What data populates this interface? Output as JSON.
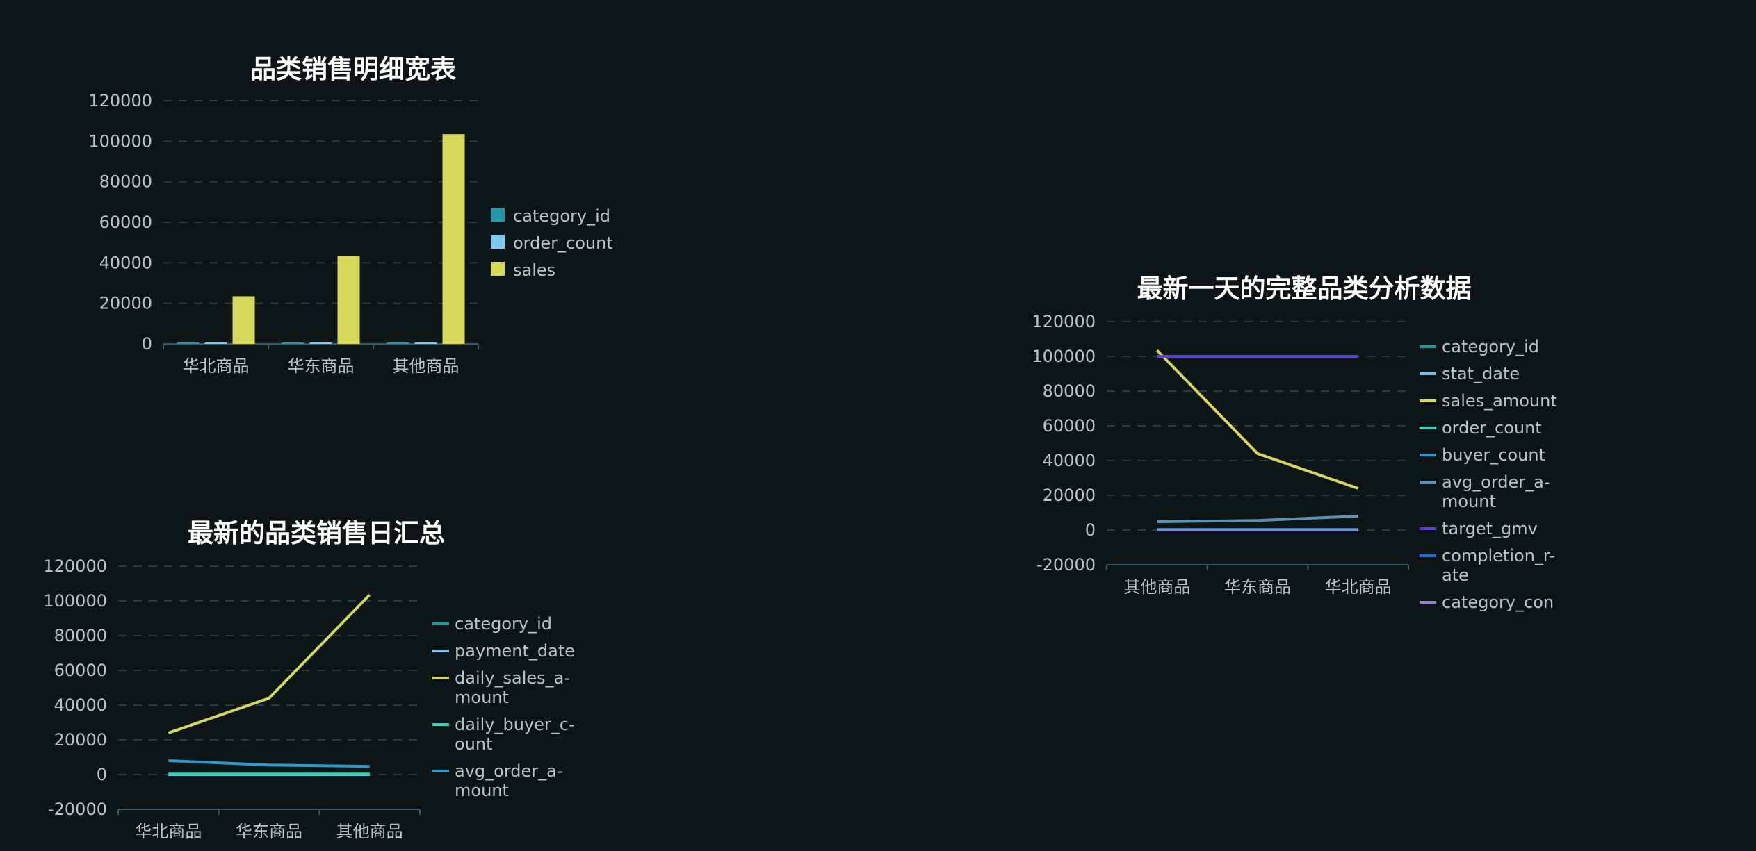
{
  "chart_data": [
    {
      "type": "bar",
      "title": "品类销售明细宽表",
      "categories": [
        "华北商品",
        "华东商品",
        "其他商品"
      ],
      "ylim": [
        0,
        120000
      ],
      "yticks": [
        "0",
        "20000",
        "40000",
        "60000",
        "80000",
        "100000",
        "120000"
      ],
      "grid": true,
      "legend_position": "right",
      "series": [
        {
          "name": "category_id",
          "color": "#2596a8",
          "values": [
            0,
            0,
            0
          ]
        },
        {
          "name": "order_count",
          "color": "#7cc9f2",
          "values": [
            0,
            0,
            0
          ]
        },
        {
          "name": "sales",
          "color": "#d6d85a",
          "values": [
            23500,
            43500,
            103500
          ]
        }
      ]
    },
    {
      "type": "line",
      "title": "最新的品类销售日汇总",
      "categories": [
        "华北商品",
        "华东商品",
        "其他商品"
      ],
      "ylim": [
        -20000,
        120000
      ],
      "yticks": [
        "-20000",
        "0",
        "20000",
        "40000",
        "60000",
        "80000",
        "100000",
        "120000"
      ],
      "grid": true,
      "legend_position": "right",
      "series": [
        {
          "name": "category_id",
          "color": "#1f9a9a",
          "values": [
            0,
            0,
            0
          ]
        },
        {
          "name": "payment_date",
          "color": "#7cc0f0",
          "values": [
            0,
            0,
            0
          ]
        },
        {
          "name": "daily_sales_a-mount",
          "color": "#d6d85a",
          "values": [
            24000,
            44000,
            103500
          ]
        },
        {
          "name": "daily_buyer_c-ount",
          "color": "#2ed8b0",
          "values": [
            300,
            300,
            300
          ]
        },
        {
          "name": "avg_order_a-mount",
          "color": "#2a9ccc",
          "values": [
            8000,
            5500,
            4700
          ]
        }
      ]
    },
    {
      "type": "line",
      "title": "最新一天的完整品类分析数据",
      "categories": [
        "其他商品",
        "华东商品",
        "华北商品"
      ],
      "ylim": [
        -20000,
        120000
      ],
      "yticks": [
        "-20000",
        "0",
        "20000",
        "40000",
        "60000",
        "80000",
        "100000",
        "120000"
      ],
      "grid": true,
      "legend_position": "right",
      "series": [
        {
          "name": "category_id",
          "color": "#1f9a9a",
          "values": [
            0,
            0,
            0
          ]
        },
        {
          "name": "stat_date",
          "color": "#7cc0f0",
          "values": [
            0,
            0,
            0
          ]
        },
        {
          "name": "sales_amount",
          "color": "#d6d85a",
          "values": [
            103500,
            44000,
            24000
          ]
        },
        {
          "name": "order_count",
          "color": "#2ed8b0",
          "values": [
            300,
            300,
            300
          ]
        },
        {
          "name": "buyer_count",
          "color": "#2a9ccc",
          "values": [
            200,
            200,
            200
          ]
        },
        {
          "name": "avg_order_a-mount",
          "color": "#5b94b8",
          "values": [
            4800,
            5500,
            8000
          ]
        },
        {
          "name": "target_gmv",
          "color": "#5a3fe0",
          "values": [
            100000,
            100000,
            100000
          ]
        },
        {
          "name": "completion_r-ate",
          "color": "#1f6fe0",
          "values": [
            1,
            1,
            1
          ]
        },
        {
          "name": "category_con",
          "color": "#8a7fd0",
          "values": [
            0,
            0,
            0
          ]
        }
      ]
    }
  ]
}
